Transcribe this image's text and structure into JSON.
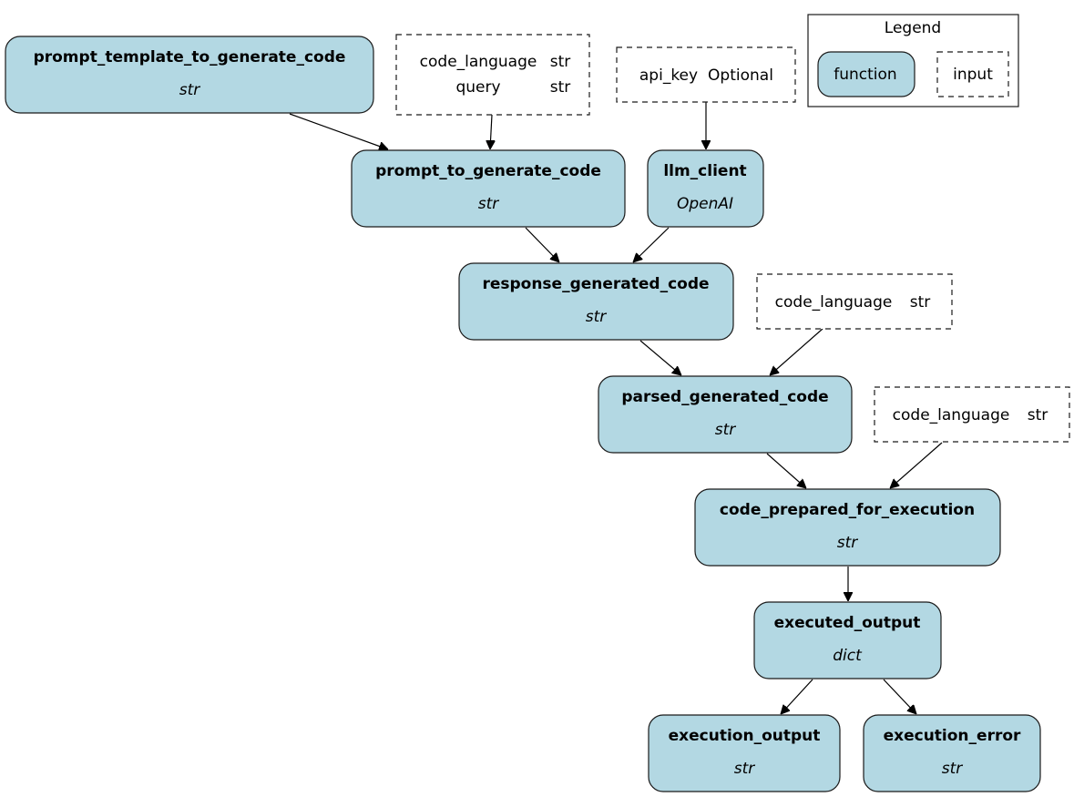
{
  "legend": {
    "title": "Legend",
    "function_label": "function",
    "input_label": "input"
  },
  "nodes": {
    "prompt_template_to_generate_code": {
      "name": "prompt_template_to_generate_code",
      "type": "str"
    },
    "prompt_to_generate_code": {
      "name": "prompt_to_generate_code",
      "type": "str"
    },
    "llm_client": {
      "name": "llm_client",
      "type": "OpenAI"
    },
    "response_generated_code": {
      "name": "response_generated_code",
      "type": "str"
    },
    "parsed_generated_code": {
      "name": "parsed_generated_code",
      "type": "str"
    },
    "code_prepared_for_execution": {
      "name": "code_prepared_for_execution",
      "type": "str"
    },
    "executed_output": {
      "name": "executed_output",
      "type": "dict"
    },
    "execution_output": {
      "name": "execution_output",
      "type": "str"
    },
    "execution_error": {
      "name": "execution_error",
      "type": "str"
    }
  },
  "inputs": {
    "prompt_inputs": [
      {
        "name": "code_language",
        "type": "str"
      },
      {
        "name": "query",
        "type": "str"
      }
    ],
    "llm_inputs": [
      {
        "name": "api_key",
        "type": "Optional"
      }
    ],
    "parse_inputs": [
      {
        "name": "code_language",
        "type": "str"
      }
    ],
    "prepare_inputs": [
      {
        "name": "code_language",
        "type": "str"
      }
    ]
  },
  "edges": [
    {
      "from": "prompt_template_to_generate_code",
      "to": "prompt_to_generate_code"
    },
    {
      "from": "inputs.prompt_inputs",
      "to": "prompt_to_generate_code"
    },
    {
      "from": "inputs.llm_inputs",
      "to": "llm_client"
    },
    {
      "from": "prompt_to_generate_code",
      "to": "response_generated_code"
    },
    {
      "from": "llm_client",
      "to": "response_generated_code"
    },
    {
      "from": "response_generated_code",
      "to": "parsed_generated_code"
    },
    {
      "from": "inputs.parse_inputs",
      "to": "parsed_generated_code"
    },
    {
      "from": "parsed_generated_code",
      "to": "code_prepared_for_execution"
    },
    {
      "from": "inputs.prepare_inputs",
      "to": "code_prepared_for_execution"
    },
    {
      "from": "code_prepared_for_execution",
      "to": "executed_output"
    },
    {
      "from": "executed_output",
      "to": "execution_output"
    },
    {
      "from": "executed_output",
      "to": "execution_error"
    }
  ],
  "colors": {
    "function_fill": "#b3d8e3",
    "stroke": "#1a1a1a"
  }
}
